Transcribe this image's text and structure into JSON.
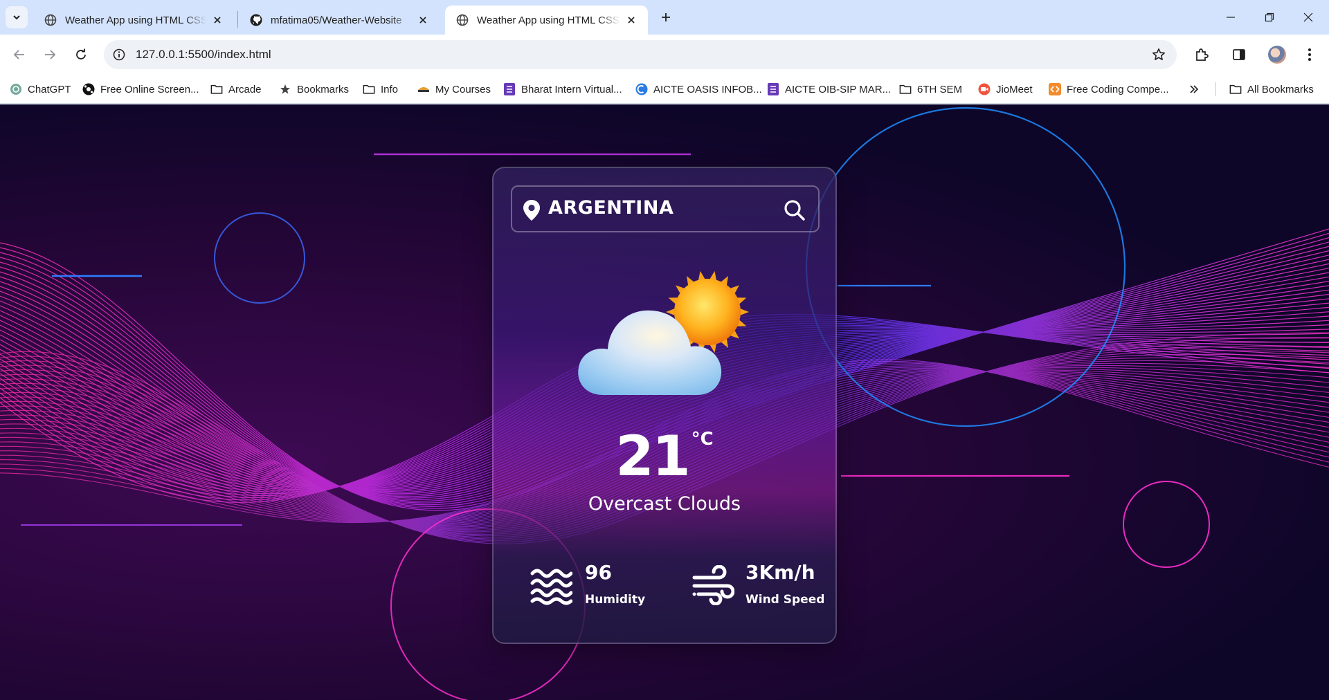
{
  "browser": {
    "tabs": [
      {
        "title": "Weather App using HTML CSS & JavaScript",
        "favicon": "globe-icon",
        "active": false
      },
      {
        "title": "mfatima05/Weather-Website",
        "favicon": "github-icon",
        "active": false
      },
      {
        "title": "Weather App using HTML CSS & JavaScript",
        "favicon": "globe-icon",
        "active": true
      }
    ],
    "url": "127.0.0.1:5500/index.html",
    "bookmarks": [
      {
        "label": "ChatGPT",
        "icon": "chatgpt-icon"
      },
      {
        "label": "Free Online Screen...",
        "icon": "screen-recorder-icon"
      },
      {
        "label": "Arcade",
        "icon": "folder-icon"
      },
      {
        "label": "Bookmarks",
        "icon": "star-icon"
      },
      {
        "label": "Info",
        "icon": "folder-icon"
      },
      {
        "label": "My Courses",
        "icon": "courses-icon"
      },
      {
        "label": "Bharat Intern Virtual...",
        "icon": "form-icon"
      },
      {
        "label": "AICTE OASIS INFOB...",
        "icon": "oasis-icon"
      },
      {
        "label": "AICTE OIB-SIP MAR...",
        "icon": "form-icon"
      },
      {
        "label": "6TH SEM",
        "icon": "folder-icon"
      },
      {
        "label": "JioMeet",
        "icon": "jiomeet-icon"
      },
      {
        "label": "Free Coding Compe...",
        "icon": "coding-icon"
      }
    ],
    "all_bookmarks_label": "All Bookmarks",
    "colors": {
      "tabstrip": "#d3e3fd",
      "toolbar": "#ffffff"
    }
  },
  "weather": {
    "location": "ARGENTINA",
    "temperature": "21",
    "unit": "°C",
    "description": "Overcast Clouds",
    "humidity": {
      "value": "96",
      "label": "Humidity"
    },
    "wind": {
      "value": "3Km/h",
      "label": "Wind Speed"
    },
    "icon": "partly-cloudy-sun-icon",
    "colors": {
      "accent_magenta": "#ff2fd0",
      "accent_blue": "#2b6bff",
      "card_text": "#ffffff"
    }
  }
}
